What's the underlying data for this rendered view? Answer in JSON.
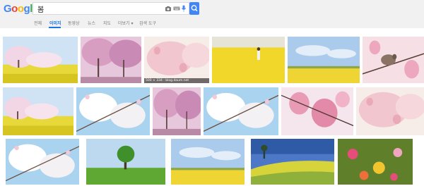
{
  "logo": {
    "letters": [
      "G",
      "o",
      "o",
      "g",
      "l",
      "e"
    ],
    "colors": [
      "#4285f4",
      "#ea4335",
      "#fbbc05",
      "#4285f4",
      "#34a853",
      "#ea4335"
    ]
  },
  "search": {
    "query": "봄"
  },
  "tabs": [
    {
      "label": "전체",
      "active": false
    },
    {
      "label": "이미지",
      "active": true
    },
    {
      "label": "동영상",
      "active": false
    },
    {
      "label": "뉴스",
      "active": false
    },
    {
      "label": "지도",
      "active": false
    },
    {
      "label": "더보기 ▾",
      "active": false
    },
    {
      "label": "검색 도구",
      "active": false
    }
  ],
  "image_caption": "500 × 334 - blog.daum.net",
  "images": [
    {
      "name": "cherry-tree-yellow-field",
      "theme": "blossom-field"
    },
    {
      "name": "pink-cherry-grove",
      "theme": "pink-grove"
    },
    {
      "name": "pink-blossom-soft",
      "theme": "pink-soft"
    },
    {
      "name": "girl-in-rapeseed-field",
      "theme": "yellow-field"
    },
    {
      "name": "rapeseed-blue-sky",
      "theme": "yellow-sky"
    },
    {
      "name": "bird-among-blossoms",
      "theme": "bird-blossom"
    },
    {
      "name": "blossom-row-rapeseed",
      "theme": "blossom-field"
    },
    {
      "name": "white-blossom-sky",
      "theme": "white-sky"
    },
    {
      "name": "cherry-path",
      "theme": "pink-grove"
    },
    {
      "name": "blossom-bokeh",
      "theme": "white-sky"
    },
    {
      "name": "pink-cherry-closeup",
      "theme": "pink-close"
    },
    {
      "name": "pale-pink-tree",
      "theme": "pink-soft"
    },
    {
      "name": "white-blossom-branch",
      "theme": "white-sky"
    },
    {
      "name": "lone-green-tree",
      "theme": "green-tree"
    },
    {
      "name": "yellow-field-trees",
      "theme": "yellow-sky"
    },
    {
      "name": "coastal-yellow-hill",
      "theme": "coast"
    },
    {
      "name": "cosmos-flowers",
      "theme": "cosmos"
    }
  ]
}
